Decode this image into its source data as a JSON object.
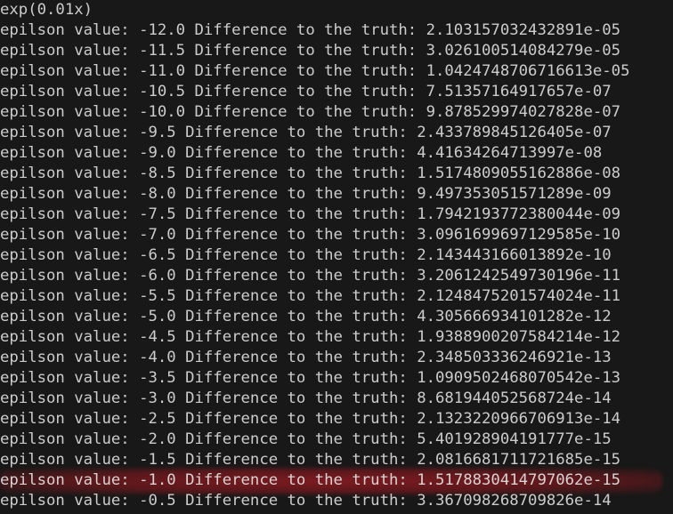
{
  "terminal": {
    "header": "exp(0.01x)",
    "lines": [
      "epilson value: -12.0 Difference to the truth: 2.103157032432891e-05",
      "epilson value: -11.5 Difference to the truth: 3.026100514084279e-05",
      "epilson value: -11.0 Difference to the truth: 1.042474870671661 3e-05",
      "epilson value: -10.5 Difference to the truth: 7.51357164917657e-07",
      "epilson value: -10.0 Difference to the truth: 9.878529974027828e-07",
      "epilson value: -9.5 Difference to the truth: 2.433789845126405e-07",
      "epilson value: -9.0 Difference to the truth: 4.41634264713997e-08",
      "epilson value: -8.5 Difference to the truth: 1.5174809055162886e-08",
      "epilson value: -8.0 Difference to the truth: 9.497353051571289e-09",
      "epilson value: -7.5 Difference to the truth: 1.7942193772380044e-09",
      "epilson value: -7.0 Difference to the truth: 3.0961699697129585e-10",
      "epilson value: -6.5 Difference to the truth: 2.14344316601 3892e-10",
      "epilson value: -6.0 Difference to the truth: 3.2061242549730196e-11",
      "epilson value: -5.5 Difference to the truth: 2.1248475201574024e-11",
      "epilson value: -5.0 Difference to the truth: 4.305666934101282e-12",
      "epilson value: -4.5 Difference to the truth: 1.9388900207584214e-12",
      "epilson value: -4.0 Difference to the truth: 2.348503336246921e-13",
      "epilson value: -3.5 Difference to the truth: 1.0909502468070542e-13",
      "epilson value: -3.0 Difference to the truth: 8.681944052568724e-14",
      "epilson value: -2.5 Difference to the truth: 2.1323220966706913e-14",
      "epilson value: -2.0 Difference to the truth: 5.401928904191777e-15",
      "epilson value: -1.5 Difference to the truth: 2.0816681711721685e-15",
      "epilson value: -1.0 Difference to the truth: 1.5178830414797062e-15",
      "epilson value: -0.5 Difference to the truth: 3.367098268709826e-14"
    ],
    "highlighted_line_index": 22
  },
  "colors": {
    "background": "#181818",
    "text": "#cccccc",
    "highlight": "#d21e28"
  }
}
